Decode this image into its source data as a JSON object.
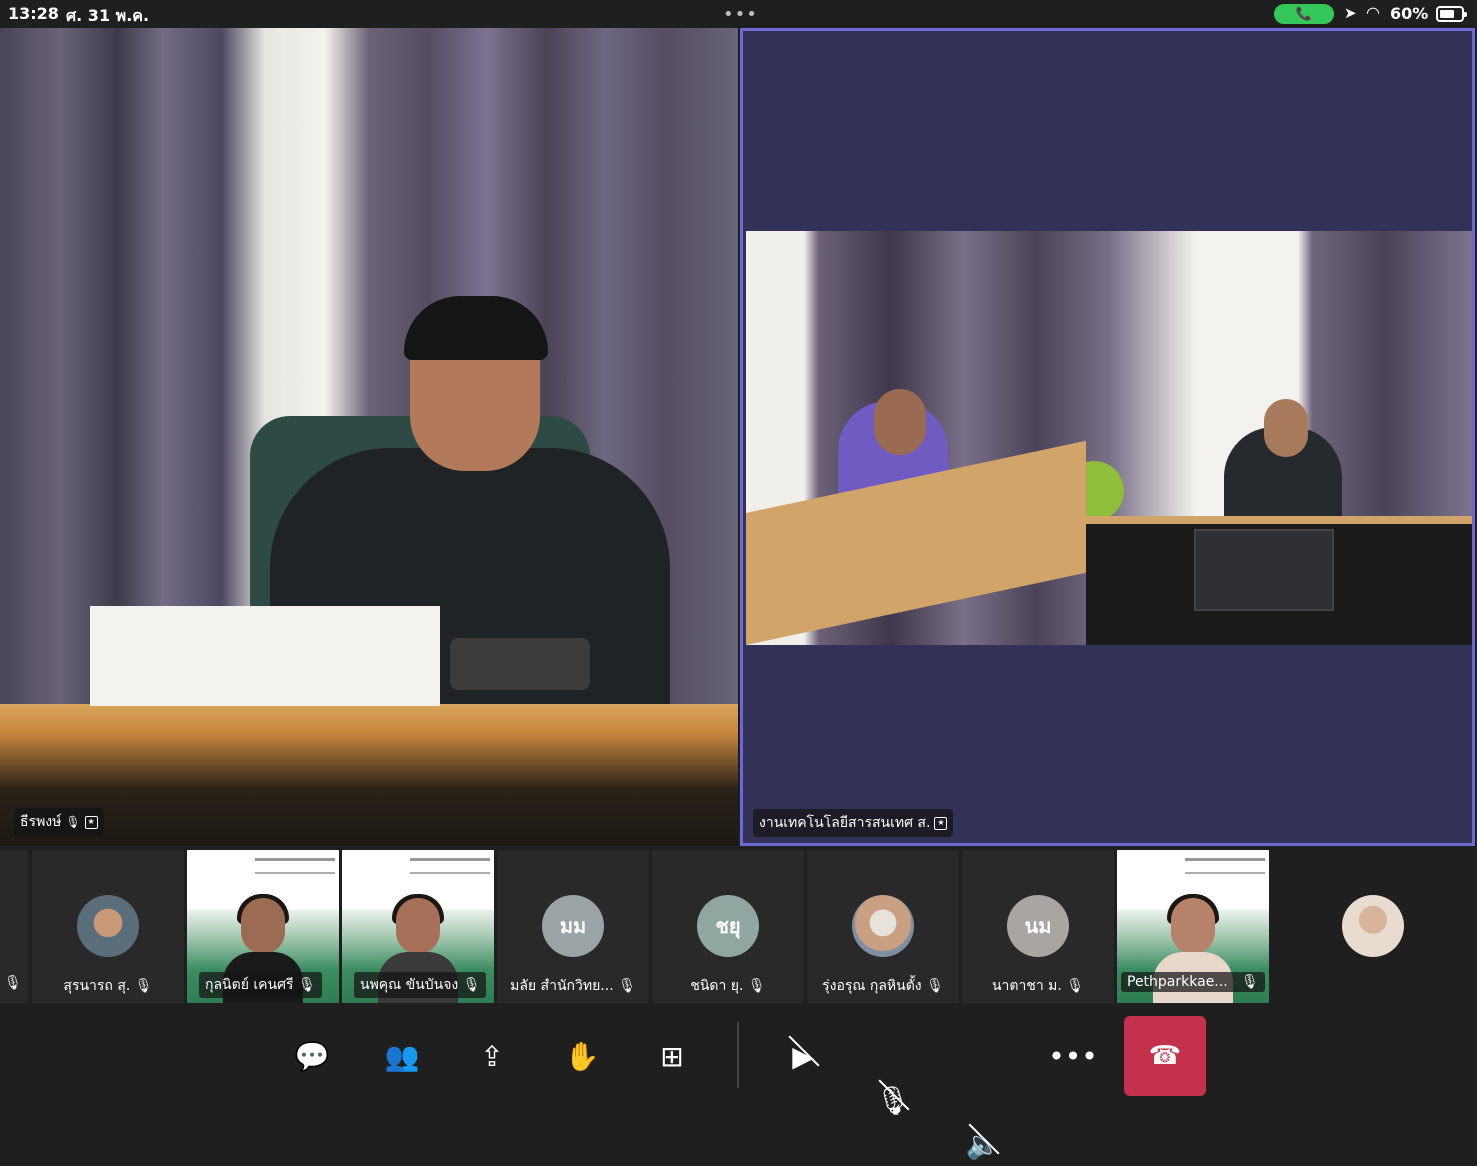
{
  "status_bar": {
    "time": "13:28",
    "date": "ศ. 31 พ.ค.",
    "more": "•••",
    "call_icon": "phone-icon",
    "battery_percent": "60%"
  },
  "main_tiles": [
    {
      "name": "ธีรพงษ์",
      "muted": true,
      "pinned": true
    },
    {
      "name": "งานเทคโนโลยีสารสนเทศ ส.",
      "muted": false,
      "pinned": true,
      "active_speaker": true
    }
  ],
  "participants": [
    {
      "label": "",
      "muted": true,
      "type": "edge"
    },
    {
      "label": "สุรนารถ สุ.",
      "muted": true,
      "type": "photo"
    },
    {
      "label": "กุลนิตย์ เคนศรี",
      "muted": true,
      "type": "video"
    },
    {
      "label": "นพคุณ ขันบันจง",
      "muted": true,
      "type": "video"
    },
    {
      "label": "มลัย สำนักวิทย...",
      "muted": true,
      "type": "initials",
      "initials": "มม"
    },
    {
      "label": "ชนิดา ยุ.",
      "muted": true,
      "type": "initials",
      "initials": "ชยุ"
    },
    {
      "label": "รุ่งอรุณ กุลหินตั้ง",
      "muted": true,
      "type": "photo"
    },
    {
      "label": "นาตาชา ม.",
      "muted": true,
      "type": "initials",
      "initials": "นม"
    },
    {
      "label": "Pethparkkae...",
      "muted": true,
      "type": "video"
    },
    {
      "label": "",
      "muted": false,
      "type": "photo"
    }
  ],
  "controls": {
    "chat": "chat-icon",
    "people": "people-icon",
    "share": "share-screen-icon",
    "raise_hand": "raise-hand-icon",
    "apps": "apps-icon",
    "camera": "camera-off-icon",
    "mic": "mic-off-icon",
    "speaker": "speaker-off-icon",
    "more": "more-icon",
    "hangup": "hangup-icon"
  },
  "colors": {
    "active_border": "#6c6bd6",
    "hangup": "#c4314b",
    "call_pill": "#34c759",
    "avatar_initials_bg": "#9aa4a6"
  },
  "glyphs": {
    "mute": "🎙̸",
    "pin": "★"
  }
}
